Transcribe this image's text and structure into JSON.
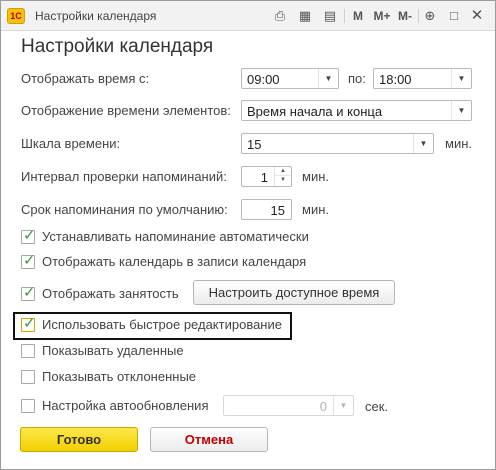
{
  "window": {
    "title": "Настройки календаря"
  },
  "toolbar": {
    "m": "M",
    "m_plus": "M+",
    "m_minus": "M-"
  },
  "heading": "Настройки календаря",
  "show_time": {
    "label": "Отображать время с:",
    "from": "09:00",
    "to_label": "по:",
    "to": "18:00"
  },
  "element_time": {
    "label": "Отображение времени элементов:",
    "value": "Время начала и конца"
  },
  "time_scale": {
    "label": "Шкала времени:",
    "value": "15",
    "unit": "мин."
  },
  "reminder_interval": {
    "label": "Интервал проверки напоминаний:",
    "value": "1",
    "unit": "мин."
  },
  "reminder_default": {
    "label": "Срок напоминания по умолчанию:",
    "value": "15",
    "unit": "мин."
  },
  "checkboxes": {
    "auto_reminder": {
      "label": "Устанавливать напоминание автоматически",
      "checked": true
    },
    "show_in_record": {
      "label": "Отображать календарь в записи календаря",
      "checked": true
    },
    "show_busy": {
      "label": "Отображать занятость",
      "checked": true
    },
    "quick_edit": {
      "label": "Использовать быстрое редактирование",
      "checked": true
    },
    "show_deleted": {
      "label": "Показывать удаленные",
      "checked": false
    },
    "show_declined": {
      "label": "Показывать отклоненные",
      "checked": false
    },
    "auto_update": {
      "label": "Настройка автообновления",
      "checked": false
    }
  },
  "auto_update": {
    "value": "0",
    "unit": "сек."
  },
  "buttons": {
    "configure_time": "Настроить доступное время",
    "ok": "Готово",
    "cancel": "Отмена"
  },
  "colors": {
    "ok_button": "#f2cf00",
    "cancel_text": "#c00000",
    "check": "#3a9a3a"
  }
}
